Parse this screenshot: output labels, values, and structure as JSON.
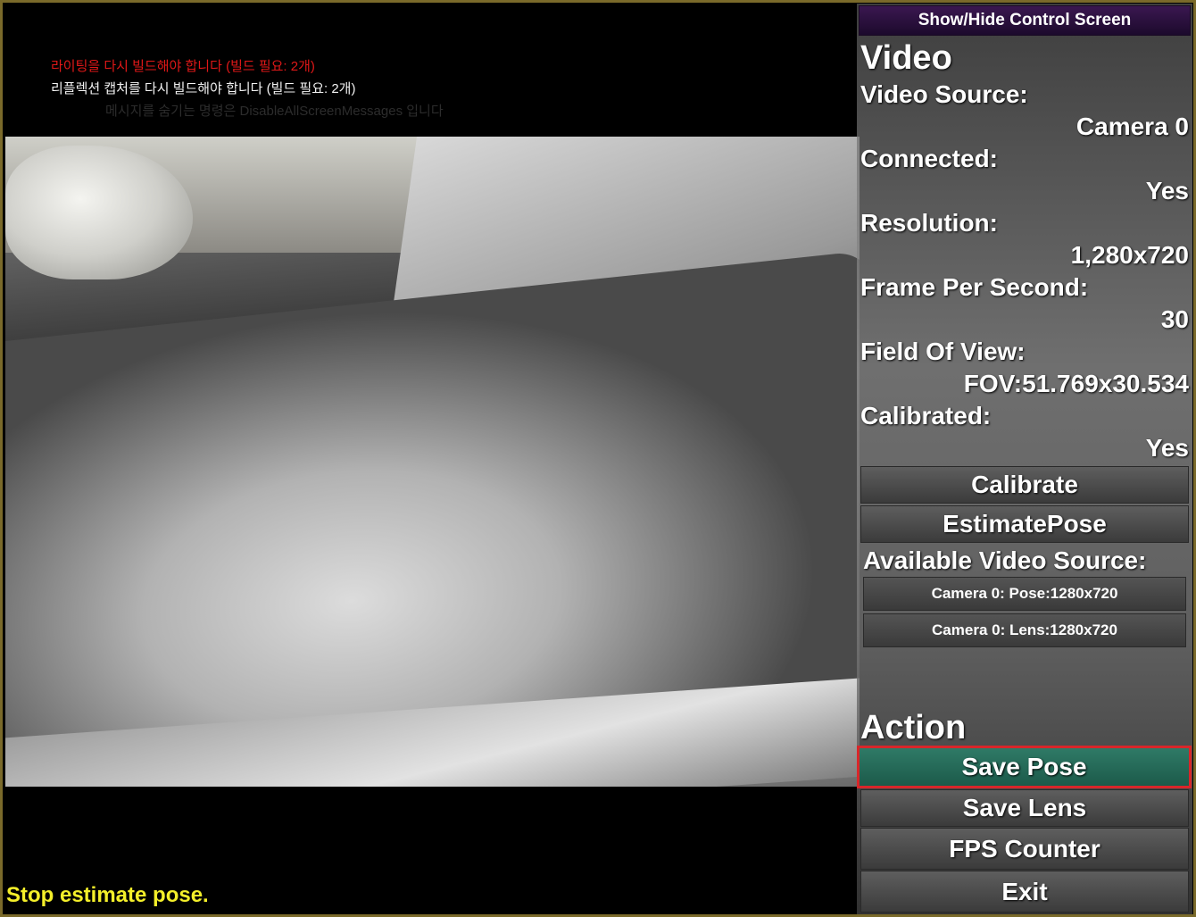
{
  "overlay": {
    "messages": [
      "라이팅을 다시 빌드해야 합니다 (빌드 필요: 2개)",
      "리플렉션 캡처를 다시 빌드해야 합니다 (빌드 필요: 2개)",
      "메시지를 숨기는 명령은 DisableAllScreenMessages 입니다"
    ],
    "status": "Stop estimate pose."
  },
  "panel": {
    "toggle_label": "Show/Hide Control Screen",
    "video_title": "Video",
    "fields": {
      "source_label": "Video Source:",
      "source_value": "Camera 0",
      "connected_label": "Connected:",
      "connected_value": "Yes",
      "resolution_label": "Resolution:",
      "resolution_value": "1,280x720",
      "fps_label": "Frame Per Second:",
      "fps_value": "30",
      "fov_label": "Field Of View:",
      "fov_value": "FOV:51.769x30.534",
      "calibrated_label": "Calibrated:",
      "calibrated_value": "Yes"
    },
    "calibrate_label": "Calibrate",
    "estimate_label": "EstimatePose",
    "available_label": "Available Video Source:",
    "sources": [
      "Camera 0: Pose:1280x720",
      "Camera 0: Lens:1280x720"
    ],
    "action_title": "Action",
    "actions": {
      "save_pose": "Save Pose",
      "save_lens": "Save Lens",
      "fps_counter": "FPS Counter",
      "exit": "Exit"
    }
  },
  "colors": {
    "status_yellow": "#f4ef2a",
    "warning_red": "#e01818",
    "active_button": "#2f7a66",
    "active_border": "#d8262a",
    "toggle_purple": "#3a1750"
  }
}
